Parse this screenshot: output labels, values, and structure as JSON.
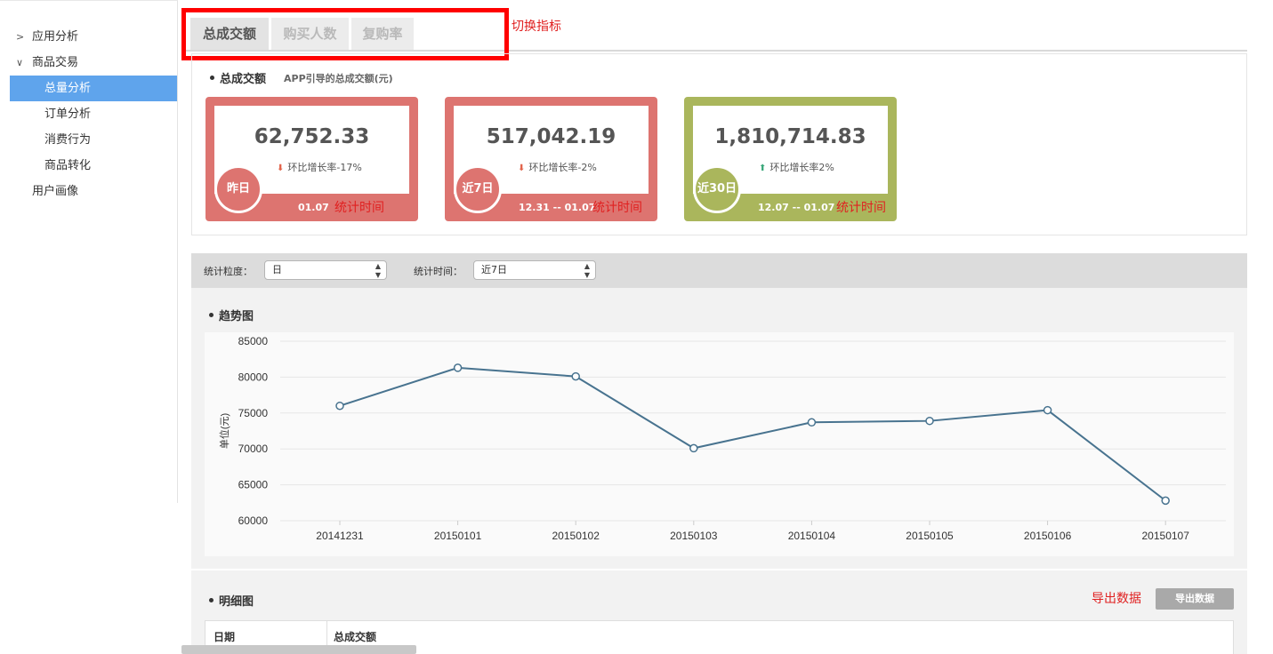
{
  "sidebar": {
    "items": [
      {
        "label": "应用分析",
        "chevron": ">"
      },
      {
        "label": "商品交易",
        "chevron": "∨"
      },
      {
        "label": "总量分析"
      },
      {
        "label": "订单分析"
      },
      {
        "label": "消费行为"
      },
      {
        "label": "商品转化"
      },
      {
        "label": "用户画像"
      }
    ]
  },
  "tabs": [
    {
      "label": "总成交额"
    },
    {
      "label": "购买人数"
    },
    {
      "label": "复购率"
    }
  ],
  "annotations": {
    "switch_metric": "切换指标",
    "export_data": "导出数据"
  },
  "summary": {
    "title": "总成交额",
    "subtitle": "APP引导的总成交额(元)",
    "cards": [
      {
        "value": "62,752.33",
        "rate": "环比增长率-17%",
        "badge": "昨日",
        "date": "01.07",
        "stat_label": "统计时间",
        "color": "#dd7470",
        "trend": "down"
      },
      {
        "value": "517,042.19",
        "rate": "环比增长率-2%",
        "badge": "近7日",
        "date": "12.31 -- 01.07",
        "stat_label": "统计时间",
        "color": "#dd7470",
        "trend": "down"
      },
      {
        "value": "1,810,714.83",
        "rate": "环比增长率2%",
        "badge": "近30日",
        "date": "12.07 -- 01.07",
        "stat_label": "统计时间",
        "color": "#aab65c",
        "trend": "up"
      }
    ]
  },
  "filters": {
    "granularity_label": "统计粒度：",
    "granularity_value": "日",
    "time_label": "统计时间：",
    "time_value": "近7日"
  },
  "trend": {
    "title": "趋势图"
  },
  "chart_data": {
    "type": "line",
    "categories": [
      "20141231",
      "20150101",
      "20150102",
      "20150103",
      "20150104",
      "20150105",
      "20150106",
      "20150107"
    ],
    "values": [
      76000,
      81300,
      80100,
      70100,
      73700,
      73900,
      75400,
      62800
    ],
    "ylabel": "单位(元)",
    "yticks": [
      85000,
      80000,
      75000,
      70000,
      65000,
      60000
    ],
    "ylim": [
      60000,
      85000
    ],
    "grid": true,
    "line_color": "#48738f"
  },
  "detail": {
    "title": "明细图",
    "export_label": "导出数据",
    "columns": [
      "日期",
      "总成交额"
    ]
  },
  "colors": {
    "accent": "#5fa4ec",
    "down_arrow": "#e2634a",
    "up_arrow": "#3aa87a",
    "annotation_red": "#e02020"
  }
}
